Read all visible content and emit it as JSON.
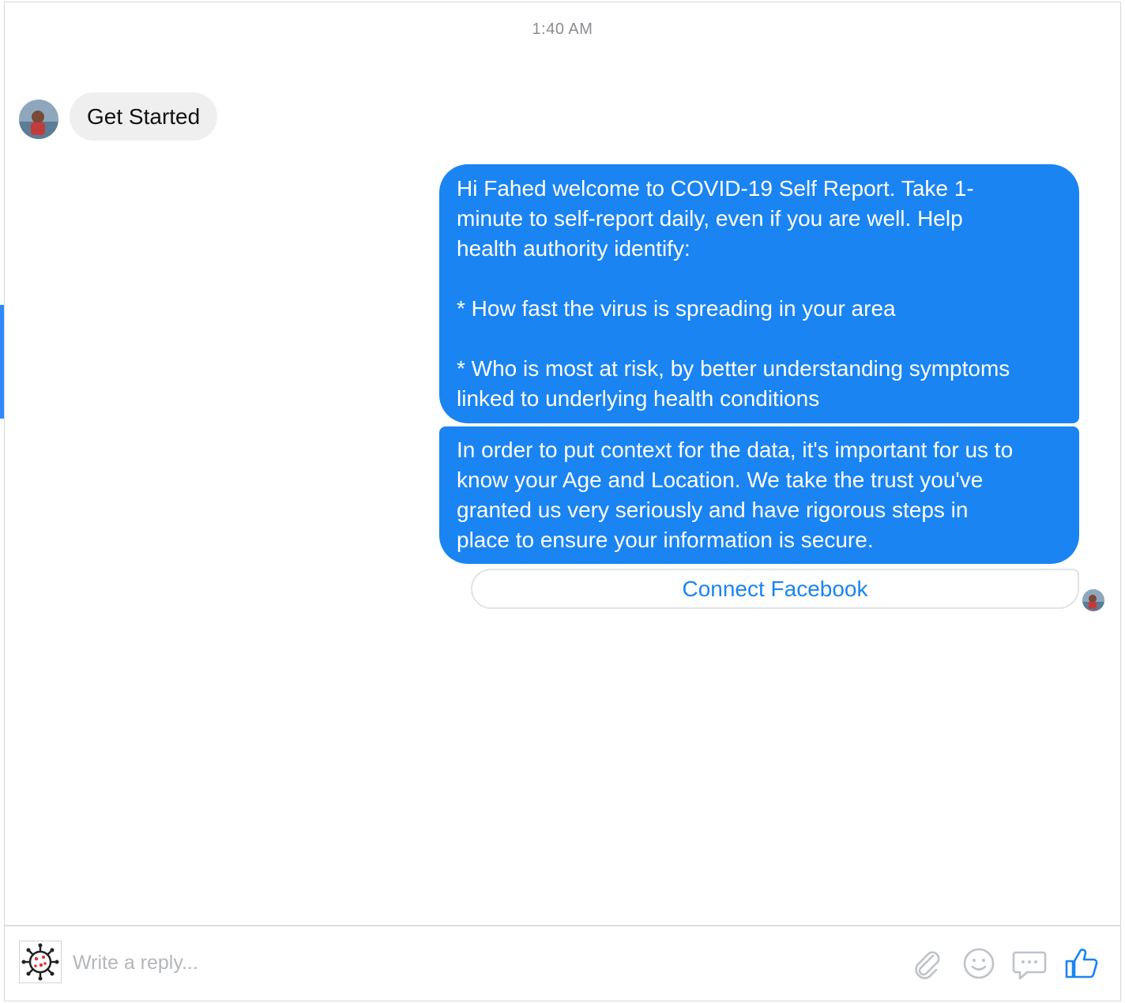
{
  "thread": {
    "timestamp": "1:40 AM"
  },
  "messages": {
    "user_postback": "Get Started",
    "bot_welcome": "Hi Fahed welcome to COVID-19 Self Report. Take 1-\nminute to self-report daily, even if you are well. Help\nhealth authority identify:\n\n* How fast the virus is spreading in your area\n\n* Who is most at risk, by better understanding symptoms\nlinked to underlying health conditions",
    "bot_context": "In order to put context for the data, it's important for us to\nknow your Age and Location. We take the trust you've\ngranted us very seriously and have rigorous steps in\nplace to ensure your information is secure."
  },
  "quick_reply": {
    "connect_label": "Connect Facebook"
  },
  "composer": {
    "placeholder": "Write a reply...",
    "icons": [
      "paperclip-icon",
      "emoji-icon",
      "chat-bubble-icon",
      "thumbs-up-icon"
    ]
  },
  "colors": {
    "bot_bubble": "#1a84f3",
    "user_bubble": "#efefef",
    "link_blue": "#1a84f3",
    "icon_gray": "#bec2c9"
  }
}
